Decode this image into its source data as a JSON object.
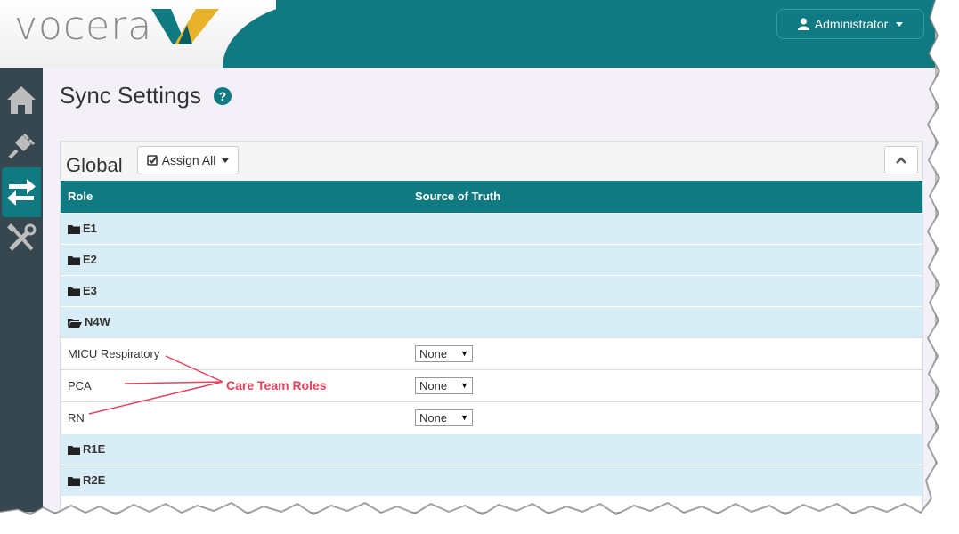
{
  "header": {
    "logo_text": "vocera",
    "user_label": "Administrator"
  },
  "sidebar": {
    "items": [
      {
        "name": "home",
        "icon": "home-icon",
        "active": false
      },
      {
        "name": "plugin",
        "icon": "plug-icon",
        "active": false
      },
      {
        "name": "sync",
        "icon": "sync-arrows-icon",
        "active": true
      },
      {
        "name": "tools",
        "icon": "tools-icon",
        "active": false
      }
    ]
  },
  "page": {
    "title": "Sync Settings",
    "help_icon": "?"
  },
  "panel": {
    "title": "Global",
    "assign_label": "Assign All",
    "table": {
      "headers": [
        "Role",
        "Source of Truth"
      ],
      "rows": [
        {
          "type": "group",
          "label": "E1",
          "open": false
        },
        {
          "type": "group",
          "label": "E2",
          "open": false
        },
        {
          "type": "group",
          "label": "E3",
          "open": false
        },
        {
          "type": "group",
          "label": "N4W",
          "open": true
        },
        {
          "type": "role",
          "label": "MICU Respiratory",
          "source": "None"
        },
        {
          "type": "role",
          "label": "PCA",
          "source": "None"
        },
        {
          "type": "role",
          "label": "RN",
          "source": "None"
        },
        {
          "type": "group",
          "label": "R1E",
          "open": false
        },
        {
          "type": "group",
          "label": "R2E",
          "open": false
        }
      ]
    }
  },
  "annotation": {
    "text": "Care Team Roles",
    "color": "#e8415c"
  },
  "colors": {
    "brand_teal": "#0f7a82",
    "group_row": "#d9edf7",
    "sidebar": "#37474f",
    "logo_yellow": "#e8b32a"
  }
}
